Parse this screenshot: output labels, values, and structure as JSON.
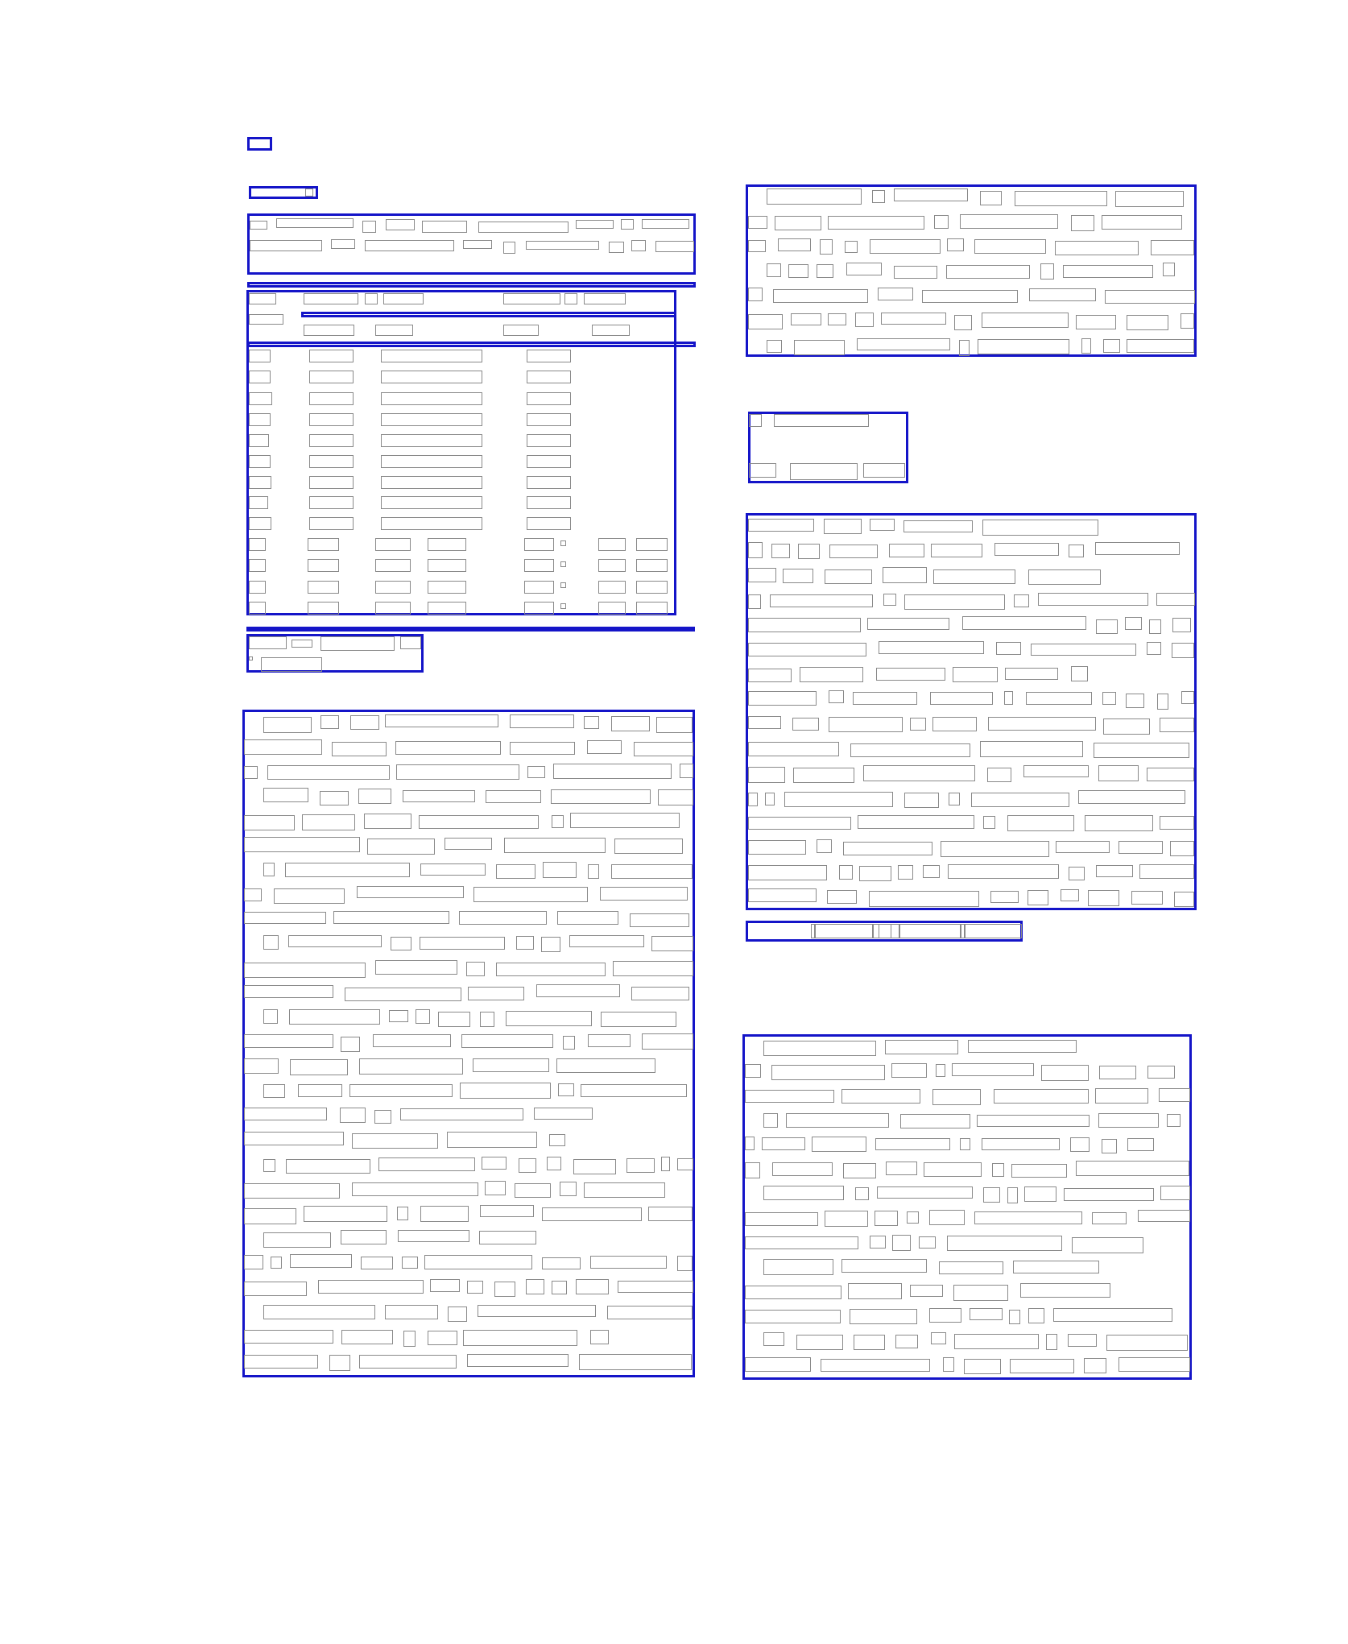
{
  "page": {
    "kind": "document-layout-mask",
    "colors": {
      "block_border": "#1414c8",
      "element_border": "#8a8a8a",
      "background": "#ffffff"
    }
  }
}
